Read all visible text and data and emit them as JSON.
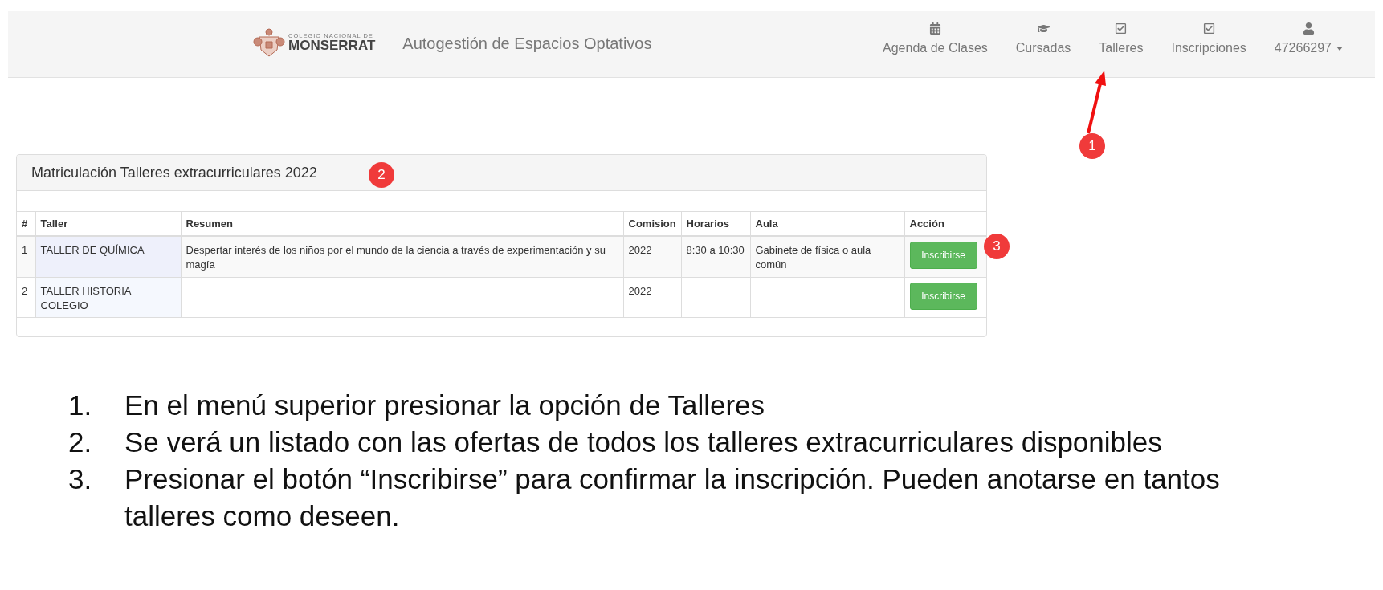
{
  "navbar": {
    "logo": {
      "small": "COLEGIO NACIONAL DE",
      "large": "MONSERRAT"
    },
    "title": "Autogestión de Espacios Optativos",
    "items": [
      {
        "label": "Agenda de Clases",
        "dropdown": false
      },
      {
        "label": "Cursadas",
        "dropdown": false
      },
      {
        "label": "Talleres",
        "dropdown": false
      },
      {
        "label": "Inscripciones",
        "dropdown": false
      },
      {
        "label": "47266297",
        "dropdown": true
      }
    ]
  },
  "panel": {
    "title": "Matriculación Talleres extracurriculares 2022",
    "columns": [
      "#",
      "Taller",
      "Resumen",
      "Comision",
      "Horarios",
      "Aula",
      "Acción"
    ],
    "rows": [
      {
        "cells": [
          "1",
          "TALLER DE QUÍMICA",
          "Despertar interés de los niños por el mundo de la ciencia a través de experimentación y su magía",
          "2022",
          "8:30 a 10:30",
          "Gabinete de física o aula común"
        ],
        "action": "Inscribirse"
      },
      {
        "cells": [
          "2",
          "TALLER HISTORIA COLEGIO",
          "",
          "2022",
          "",
          ""
        ],
        "action": "Inscribirse"
      }
    ]
  },
  "callouts": [
    "1",
    "2",
    "3"
  ],
  "steps": [
    {
      "number": "1.",
      "text": "En el menú superior presionar la opción de Talleres"
    },
    {
      "number": "2.",
      "text": "Se verá un listado con las ofertas de todos los talleres extracurriculares disponibles"
    },
    {
      "number": "3.",
      "text": "Presionar el botón “Inscribirse” para confirmar la inscripción. Pueden anotarse en tantos talleres como deseen."
    }
  ]
}
